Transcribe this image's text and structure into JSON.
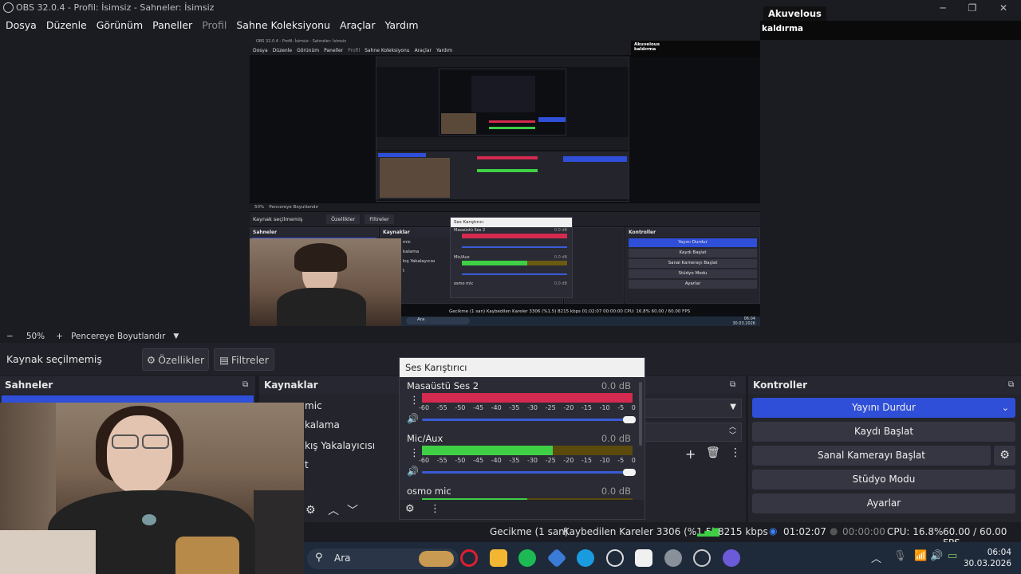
{
  "window": {
    "title": "OBS 32.0.4 - Profil: İsimsiz - Sahneler: İsimsiz",
    "controls": [
      "minimize",
      "maximize",
      "close"
    ]
  },
  "menu": [
    {
      "label": "Dosya",
      "disabled": false
    },
    {
      "label": "Düzenle",
      "disabled": false
    },
    {
      "label": "Görünüm",
      "disabled": false
    },
    {
      "label": "Paneller",
      "disabled": false
    },
    {
      "label": "Profil",
      "disabled": true
    },
    {
      "label": "Sahne Koleksiyonu",
      "disabled": false
    },
    {
      "label": "Araçlar",
      "disabled": false
    },
    {
      "label": "Yardım",
      "disabled": false
    }
  ],
  "overlay": {
    "name": "Akuvelous",
    "subtitle": "kaldırma"
  },
  "zoom": {
    "minus": "−",
    "value": "50%",
    "plus": "+",
    "mode": "Pencereye Boyutlandır"
  },
  "source_bar": {
    "label": "Kaynak seçilmemiş",
    "properties": "Özellikler",
    "filters": "Filtreler"
  },
  "docks": {
    "scenes": {
      "title": "Sahneler"
    },
    "sources": {
      "title": "Kaynaklar",
      "items": [
        "mic",
        "kalama",
        "kış Yakalayıcısı",
        "t"
      ]
    },
    "controls": {
      "title": "Kontroller",
      "stream": "Yayını Durdur",
      "record": "Kaydı Başlat",
      "virtualcam": "Sanal Kamerayı Başlat",
      "studio": "Stüdyo Modu",
      "settings": "Ayarlar"
    }
  },
  "mixer": {
    "title": "Ses Karıştırıcı",
    "scale": [
      "-60",
      "-55",
      "-50",
      "-45",
      "-40",
      "-35",
      "-30",
      "-25",
      "-20",
      "-15",
      "-10",
      "-5",
      "0"
    ],
    "channels": [
      {
        "name": "Masaüstü Ses 2",
        "db": "0.0 dB",
        "level": 1.0,
        "color": "#d42a4f"
      },
      {
        "name": "Mic/Aux",
        "db": "0.0 dB",
        "level": 0.62,
        "color": "#3fcf45"
      },
      {
        "name": "osmo mic",
        "db": "0.0 dB",
        "level": 0.5,
        "color": "#3fcf45"
      }
    ]
  },
  "status": {
    "delay": "Gecikme (1 san)",
    "dropped": "Kaybedilen Kareler 3306 (%1.5)",
    "bitrate": "8215 kbps",
    "stream_time": "01:02:07",
    "rec_time": "00:00:00",
    "cpu": "CPU: 16.8%",
    "fps": "60.00 / 60.00 FPS"
  },
  "taskbar": {
    "search": "Ara",
    "time": "06:04",
    "date": "30.03.2026"
  },
  "nested": {
    "title": "OBS 32.0.4 - Profil: İsimsiz - Sahneler: İsimsiz",
    "menu": [
      "Dosya",
      "Düzenle",
      "Görünüm",
      "Paneller",
      "Profil",
      "Sahne Koleksiyonu",
      "Araçlar",
      "Yardım"
    ],
    "name": "Akuvelous",
    "subtitle": "kaldırma",
    "zoom": "50%",
    "zoom_mode": "Pencereye Boyutlandır",
    "source_label": "Kaynak seçilmemiş",
    "properties": "Özellikler",
    "filters": "Filtreler",
    "mixer_title": "Ses Karıştırıcı",
    "scenes": "Sahneler",
    "sources": "Kaynaklar",
    "controls": "Kontroller",
    "source_items": [
      "mic",
      "kalama",
      "kış Yakalayıcısı",
      "t"
    ],
    "ch1": "Masaüstü Ses 2",
    "ch2": "Mic/Aux",
    "ch3": "osmo mic",
    "db": "0.0 dB",
    "stream": "Yayını Durdur",
    "record": "Kaydı Başlat",
    "virtualcam": "Sanal Kamerayı Başlat",
    "studio": "Stüdyo Modu",
    "settings": "Ayarlar",
    "status": "Gecikme (1 san)   Kaybedilen Kareler 3306 (%1.5)   8215 kbps   01:02:07   00:00:00   CPU: 16.8%   60.00 / 60.00 FPS",
    "search": "Ara",
    "time": "06:04",
    "date": "30.03.2026"
  }
}
